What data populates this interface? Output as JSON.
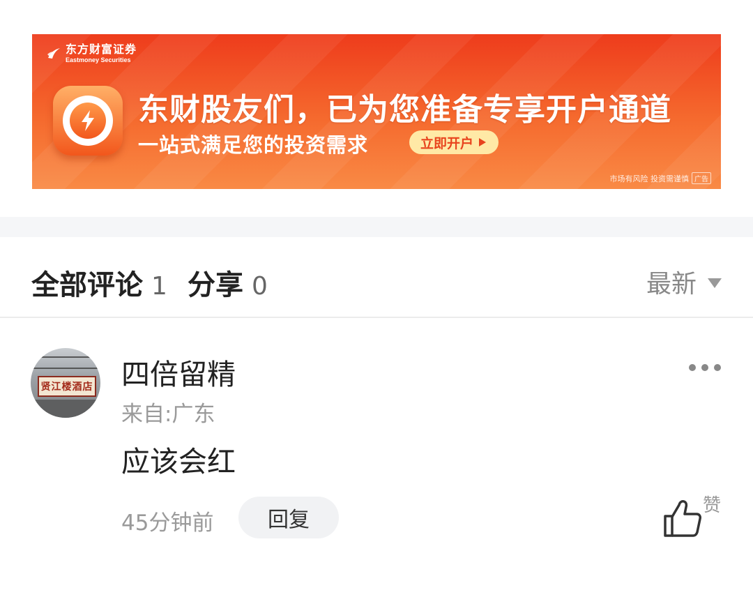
{
  "banner": {
    "brand_cn": "东方财富证券",
    "brand_en": "Eastmoney Securities",
    "headline": "东财股友们，已为您准备专享开户通道",
    "subline": "一站式满足您的投资需求",
    "cta_label": "立即开户",
    "risk_notice": "市场有风险 投资需谨慎",
    "ad_tag": "广告",
    "colors": {
      "top": "#ee3c1c",
      "bottom": "#f98a45",
      "cta_bg": "#ffe9a6"
    }
  },
  "comments": {
    "all_label": "全部评论",
    "all_count": "1",
    "share_label": "分享",
    "share_count": "0",
    "sort_label": "最新"
  },
  "comment": {
    "username": "四倍留精",
    "location": "来自:广东",
    "text": "应该会红",
    "time": "45分钟前",
    "reply_label": "回复",
    "like_label": "赞",
    "avatar_sign": "贤江楼酒店",
    "icons": [
      "more-icon",
      "thumbs-up-icon",
      "lightning-icon",
      "brand-logo-icon"
    ]
  }
}
